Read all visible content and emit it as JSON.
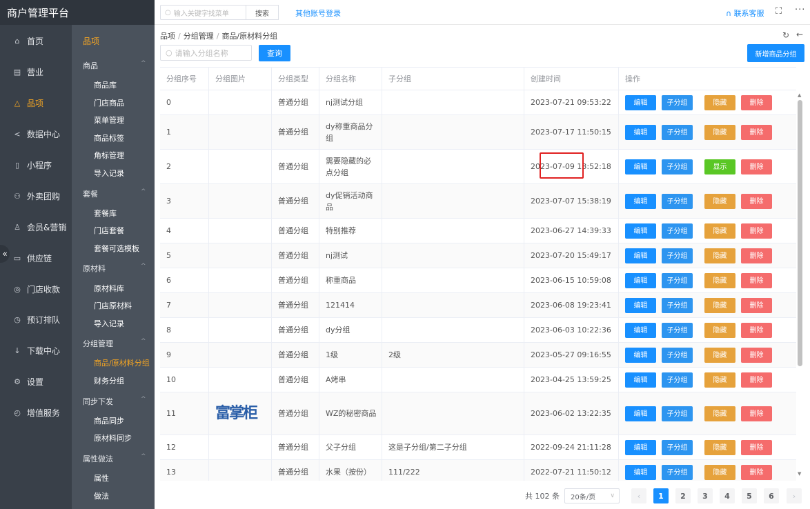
{
  "app": {
    "title": "商户管理平台"
  },
  "main_nav": [
    {
      "label": "首页",
      "icon": "home-icon",
      "glyph": "⌂"
    },
    {
      "label": "营业",
      "icon": "calendar-icon",
      "glyph": "▤"
    },
    {
      "label": "品项",
      "icon": "bag-icon",
      "glyph": "△",
      "active": true
    },
    {
      "label": "数据中心",
      "icon": "share-icon",
      "glyph": "<"
    },
    {
      "label": "小程序",
      "icon": "phone-icon",
      "glyph": "▯"
    },
    {
      "label": "外卖团购",
      "icon": "bike-icon",
      "glyph": "⚇"
    },
    {
      "label": "会员&营销",
      "icon": "user-icon",
      "glyph": "♙"
    },
    {
      "label": "供应链",
      "icon": "truck-icon",
      "glyph": "▭"
    },
    {
      "label": "门店收款",
      "icon": "wallet-icon",
      "glyph": "◎"
    },
    {
      "label": "预订排队",
      "icon": "clock-icon",
      "glyph": "◷"
    },
    {
      "label": "下载中心",
      "icon": "download-icon",
      "glyph": "↓"
    },
    {
      "label": "设置",
      "icon": "gear-icon",
      "glyph": "⚙"
    },
    {
      "label": "增值服务",
      "icon": "alarm-icon",
      "glyph": "◴"
    }
  ],
  "sub_nav": {
    "top_label": "品项",
    "groups": [
      {
        "label": "商品",
        "items": [
          "商品库",
          "门店商品",
          "菜单管理",
          "商品标签",
          "角标管理",
          "导入记录"
        ]
      },
      {
        "label": "套餐",
        "items": [
          "套餐库",
          "门店套餐",
          "套餐可选模板"
        ]
      },
      {
        "label": "原材料",
        "items": [
          "原材料库",
          "门店原材料",
          "导入记录"
        ]
      },
      {
        "label": "分组管理",
        "items": [
          "商品/原材料分组",
          "财务分组"
        ]
      },
      {
        "label": "同步下发",
        "items": [
          "商品同步",
          "原材料同步"
        ]
      },
      {
        "label": "属性做法",
        "items": [
          "属性",
          "做法"
        ]
      }
    ]
  },
  "topbar": {
    "search_placeholder": "输入关键字找菜单",
    "search_button": "搜索",
    "other_login": "其他账号登录",
    "contact": "联系客服"
  },
  "breadcrumb": [
    "品项",
    "分组管理",
    "商品/原材料分组"
  ],
  "filter": {
    "placeholder": "请输入分组名称",
    "query_button": "查询",
    "new_button": "新增商品分组"
  },
  "table": {
    "headers": [
      "分组序号",
      "分组图片",
      "分组类型",
      "分组名称",
      "子分组",
      "创建时间",
      "操作"
    ],
    "actions": {
      "edit": "编辑",
      "sub": "子分组",
      "hide": "隐藏",
      "show": "显示",
      "delete": "删除"
    },
    "rows": [
      {
        "no": "0",
        "type": "普通分组",
        "name": "nj测试分组",
        "sub": "",
        "time": "2023-07-21 09:53:22",
        "toggle": "hide"
      },
      {
        "no": "1",
        "type": "普通分组",
        "name": "dy称重商品分组",
        "sub": "",
        "time": "2023-07-17 11:50:15",
        "toggle": "hide"
      },
      {
        "no": "2",
        "type": "普通分组",
        "name": "需要隐藏的必点分组",
        "sub": "",
        "time": "2023-07-09 13:52:18",
        "toggle": "show"
      },
      {
        "no": "3",
        "type": "普通分组",
        "name": "dy促销活动商品",
        "sub": "",
        "time": "2023-07-07 15:38:19",
        "toggle": "hide"
      },
      {
        "no": "4",
        "type": "普通分组",
        "name": "特别推荐",
        "sub": "",
        "time": "2023-06-27 14:39:33",
        "toggle": "hide"
      },
      {
        "no": "5",
        "type": "普通分组",
        "name": "nj测试",
        "sub": "",
        "time": "2023-07-20 15:49:17",
        "toggle": "hide"
      },
      {
        "no": "6",
        "type": "普通分组",
        "name": "称重商品",
        "sub": "",
        "time": "2023-06-15 10:59:08",
        "toggle": "hide"
      },
      {
        "no": "7",
        "type": "普通分组",
        "name": "121414",
        "sub": "",
        "time": "2023-06-08 19:23:41",
        "toggle": "hide"
      },
      {
        "no": "8",
        "type": "普通分组",
        "name": "dy分组",
        "sub": "",
        "time": "2023-06-03 10:22:36",
        "toggle": "hide"
      },
      {
        "no": "9",
        "type": "普通分组",
        "name": "1级",
        "sub": "2级",
        "time": "2023-05-27 09:16:55",
        "toggle": "hide"
      },
      {
        "no": "10",
        "type": "普通分组",
        "name": "A烤串",
        "sub": "",
        "time": "2023-04-25 13:59:25",
        "toggle": "hide"
      },
      {
        "no": "11",
        "type": "普通分组",
        "name": "WZ的秘密商品",
        "sub": "",
        "time": "2023-06-02 13:22:35",
        "toggle": "hide",
        "image_text": "富掌柜"
      },
      {
        "no": "12",
        "type": "普通分组",
        "name": "父子分组",
        "sub": "这是子分组/第二子分组",
        "time": "2022-09-24 21:11:28",
        "toggle": "hide"
      },
      {
        "no": "13",
        "type": "普通分组",
        "name": "水果（按份）",
        "sub": "111/222",
        "time": "2022-07-21 11:50:12",
        "toggle": "hide"
      }
    ]
  },
  "pagination": {
    "total": "共 102 条",
    "page_size": "20条/页",
    "pages": [
      "1",
      "2",
      "3",
      "4",
      "5",
      "6"
    ],
    "current": "1"
  },
  "colors": {
    "accent": "#1890ff",
    "active": "#f5a623",
    "hide": "#e6a23c",
    "show": "#5ac725",
    "delete": "#f56c6c"
  }
}
